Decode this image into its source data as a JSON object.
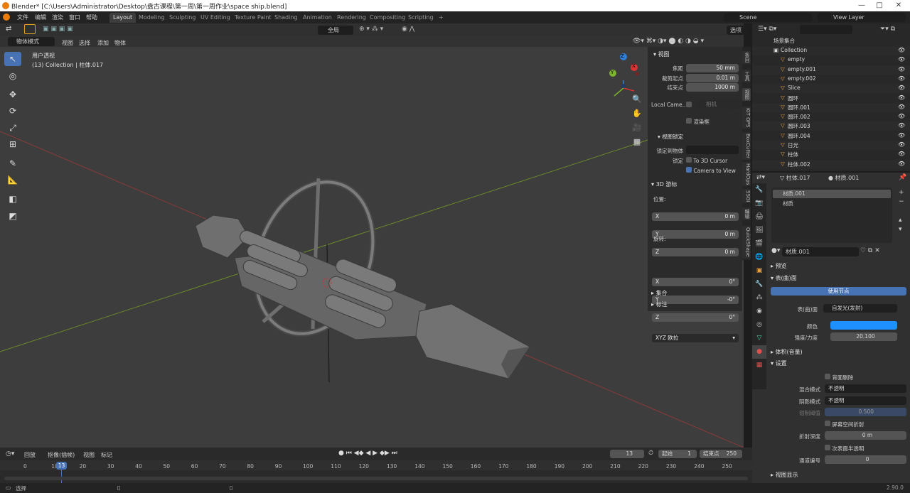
{
  "window": {
    "title": "Blender* [C:\\Users\\Administrator\\Desktop\\盘古课程\\第一周\\第一周作业\\space ship.blend]",
    "min": "—",
    "max": "□",
    "close": "✕"
  },
  "menus": [
    "文件",
    "编辑",
    "渲染",
    "窗口",
    "帮助"
  ],
  "workspaces": [
    "Layout",
    "Modeling",
    "Sculpting",
    "UV Editing",
    "Texture Paint",
    "Shading",
    "Animation",
    "Rendering",
    "Compositing",
    "Scripting"
  ],
  "add_workspace": "+",
  "scene": {
    "name": "Scene",
    "view_layer": "View Layer"
  },
  "viewport": {
    "transform_orientation": "全局",
    "mode": "物体模式",
    "header_menus": [
      "视图",
      "选择",
      "添加",
      "物体"
    ],
    "options": "选项",
    "overlay_title": "用户透视",
    "overlay_sub": "(13) Collection | 柱体.017",
    "gizmo": {
      "x": "X",
      "y": "Y",
      "z": "Z"
    }
  },
  "npanel": {
    "view_section": "视图",
    "focal_label": "焦距",
    "focal": "50 mm",
    "clip_start_label": "裁剪起点",
    "clip_start": "0.01 m",
    "clip_end_label": "结束点",
    "clip_end": "1000 m",
    "local_camera": "Local Came...",
    "camera_placeholder": "相机",
    "render_border": "渲染框",
    "view_lock": "视图锁定",
    "lock_to_object": "锁定到物体",
    "lock_label": "锁定",
    "to_3d_cursor": "To 3D Cursor",
    "camera_to_view": "Camera to View",
    "cursor_section": "3D 游标",
    "location_label": "位置:",
    "loc": [
      {
        "axis": "X",
        "val": "0 m"
      },
      {
        "axis": "Y",
        "val": "0 m"
      },
      {
        "axis": "Z",
        "val": "0 m"
      }
    ],
    "rotation_label": "旋转:",
    "rot": [
      {
        "axis": "X",
        "val": "0°"
      },
      {
        "axis": "Y",
        "val": "-0°"
      },
      {
        "axis": "Z",
        "val": "0°"
      }
    ],
    "rot_mode": "XYZ 欧拉",
    "collection": "集合",
    "annotation": "标注",
    "tabs": [
      "条目",
      "工具",
      "视图",
      "KIT OPS",
      "BoxCutter",
      "HardOps",
      "SSGI",
      "编辑",
      "QuickShape"
    ]
  },
  "outliner": {
    "search_placeholder": "",
    "root": "场景集合",
    "items": [
      {
        "name": "Collection",
        "depth": 1
      },
      {
        "name": "empty",
        "depth": 2
      },
      {
        "name": "empty.001",
        "depth": 2
      },
      {
        "name": "empty.002",
        "depth": 2
      },
      {
        "name": "Slice",
        "depth": 2
      },
      {
        "name": "圆环",
        "depth": 2
      },
      {
        "name": "圆环.001",
        "depth": 2
      },
      {
        "name": "圆环.002",
        "depth": 2
      },
      {
        "name": "圆环.003",
        "depth": 2
      },
      {
        "name": "圆环.004",
        "depth": 2
      },
      {
        "name": "日光",
        "depth": 2
      },
      {
        "name": "柱体",
        "depth": 2
      },
      {
        "name": "柱体.002",
        "depth": 2
      }
    ]
  },
  "properties": {
    "object": "柱体.017",
    "material": "材质.001",
    "slots": [
      "材质.001",
      "材质"
    ],
    "material_field": "材质.001",
    "preview": "预览",
    "surface": "表(曲)面",
    "use_nodes": "使用节点",
    "surface_label": "表(曲)面",
    "surface_value": "自发光(发射)",
    "color_label": "颜色",
    "color_value": "#1e90ff",
    "strength_label": "强度/力度",
    "strength": "20.100",
    "volume": "体积(音量)",
    "settings": "设置",
    "backface": "背面剔除",
    "blend_label": "混合模式",
    "blend": "不透明",
    "shadow_label": "阴影模式",
    "shadow": "不透明",
    "clip_label": "钳制阈值",
    "clip": "0.500",
    "ssr": "屏幕空间折射",
    "refr_depth_label": "折射深度",
    "refr_depth": "0 m",
    "sss": "次表面半透明",
    "pass_label": "通道编号",
    "pass": "0",
    "viewport_display": "视图显示"
  },
  "timeline": {
    "menus": [
      "回放",
      "抠像(插帧)",
      "视图",
      "标记"
    ],
    "current": "13",
    "start_label": "起始",
    "start": "1",
    "end_label": "结束点",
    "end": "250",
    "ticks": [
      "0",
      "10",
      "20",
      "30",
      "40",
      "50",
      "60",
      "70",
      "80",
      "90",
      "100",
      "110",
      "120",
      "130",
      "140",
      "150",
      "160",
      "170",
      "180",
      "190",
      "200",
      "210",
      "220",
      "230",
      "240",
      "250"
    ],
    "playhead": "13"
  },
  "status": {
    "select": "选择",
    "version": "2.90.0"
  }
}
